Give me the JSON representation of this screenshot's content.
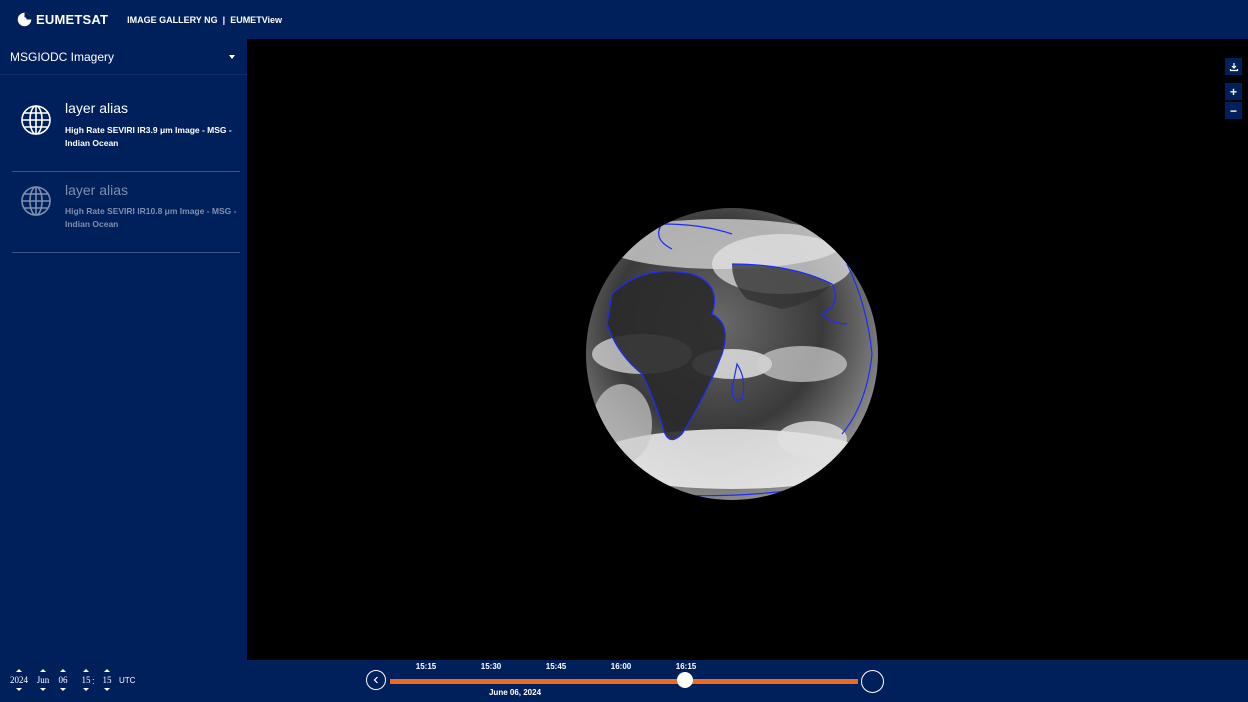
{
  "header": {
    "brand": "EUMETSAT",
    "nav_gallery": "IMAGE GALLERY NG",
    "nav_separator": "|",
    "nav_view": "EUMETView"
  },
  "sidebar": {
    "title": "MSGIODC Imagery",
    "layers": [
      {
        "alias": "layer alias",
        "description": "High Rate SEVIRI IR3.9 μm Image - MSG - Indian Ocean",
        "active": true
      },
      {
        "alias": "layer alias",
        "description": "High Rate SEVIRI IR10.8 μm Image - MSG - Indian Ocean",
        "active": false
      }
    ]
  },
  "map": {
    "controls": {
      "download": "download-icon",
      "zoom_in": "+",
      "zoom_out": "−"
    }
  },
  "datetime": {
    "year": "2024",
    "month": "Jun",
    "day": "06",
    "hour": "15",
    "separator": ":",
    "minute": "15",
    "timezone": "UTC"
  },
  "timeline": {
    "ticks": [
      "15:15",
      "15:30",
      "15:45",
      "16:00",
      "16:15"
    ],
    "date": "June 06, 2024",
    "progress": 0.63,
    "colors": {
      "track": "#ee6a21",
      "bar": "#00205b"
    }
  }
}
